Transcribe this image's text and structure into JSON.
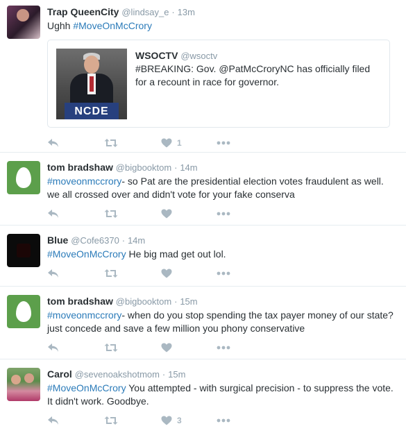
{
  "tweets": [
    {
      "fullname": "Trap QueenCity",
      "username": "@lindsay_e",
      "separator": "·",
      "time": "13m",
      "prefix": "Ughh ",
      "hashtag": "#MoveOnMcCrory",
      "rest": "",
      "like_count": "1",
      "quote": {
        "fullname": "WSOCTV",
        "username": "@wsoctv",
        "text": "#BREAKING: Gov. @PatMcCroryNC has officially filed for a recount in race for governor.",
        "image_podium_text": "NCDE"
      }
    },
    {
      "fullname": "tom bradshaw",
      "username": "@bigbooktom",
      "separator": "·",
      "time": "14m",
      "prefix": "",
      "hashtag": "#moveonmccrory",
      "rest": "- so Pat are the presidential election votes fraudulent as well. we all crossed over and didn't vote for your fake conserva",
      "like_count": ""
    },
    {
      "fullname": "Blue",
      "username": "@Cofe6370",
      "separator": "·",
      "time": "14m",
      "prefix": "",
      "hashtag": "#MoveOnMcCrory",
      "rest": " He big mad get out lol.",
      "like_count": ""
    },
    {
      "fullname": "tom bradshaw",
      "username": "@bigbooktom",
      "separator": "·",
      "time": "15m",
      "prefix": "",
      "hashtag": "#moveonmccrory",
      "rest": "- when do you stop spending the tax payer money of our state? just concede and save a few million you phony conservative",
      "like_count": ""
    },
    {
      "fullname": "Carol",
      "username": "@sevenoakshotmom",
      "separator": "·",
      "time": "15m",
      "prefix": "",
      "hashtag": "#MoveOnMcCrory",
      "rest": " You attempted - with surgical precision - to suppress the vote. It didn't work. Goodbye.",
      "like_count": "3"
    }
  ],
  "colors": {
    "link": "#2b7bb9",
    "muted": "#8899a6",
    "action_icon": "#aab8c2",
    "divider": "#e6ecf0"
  },
  "icons": [
    "reply-icon",
    "retweet-icon",
    "heart-icon",
    "more-icon"
  ]
}
